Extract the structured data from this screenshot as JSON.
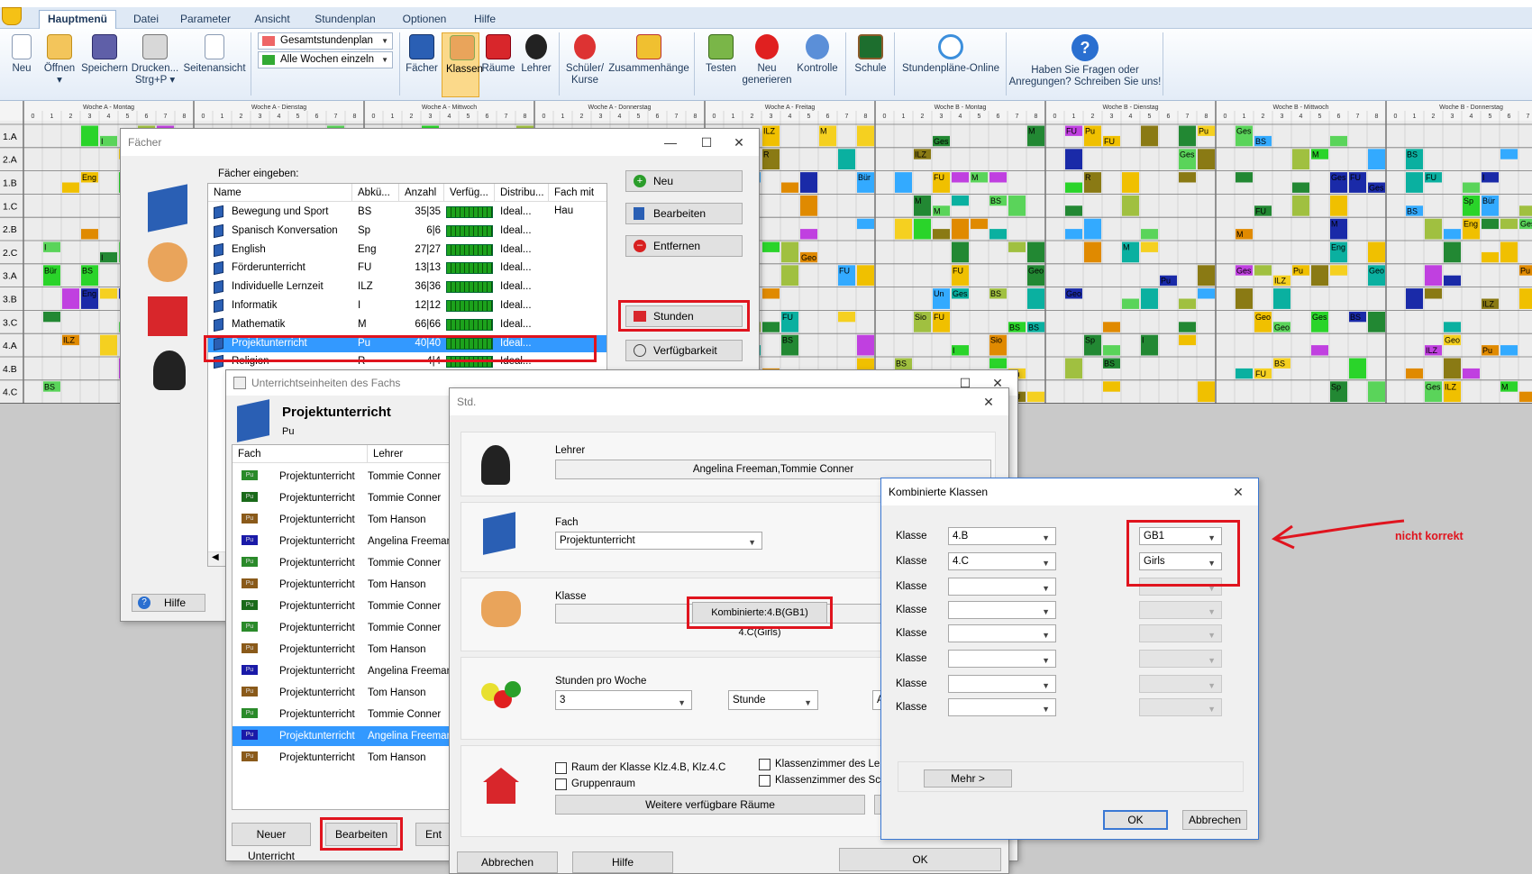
{
  "menu": {
    "tabs": [
      "Hauptmenü",
      "Datei",
      "Parameter",
      "Ansicht",
      "Stundenplan",
      "Optionen",
      "Hilfe"
    ]
  },
  "ribbon": {
    "buttons": [
      {
        "label": "Neu",
        "icon": "new-document-icon"
      },
      {
        "label": "Öffnen",
        "icon": "folder-open-icon"
      },
      {
        "label": "Speichern",
        "icon": "floppy-save-icon"
      },
      {
        "label": "Drucken...",
        "sub": "Strg+P",
        "icon": "printer-icon"
      },
      {
        "label": "Seitenansicht",
        "icon": "print-preview-icon"
      },
      {
        "label": "Fächer",
        "icon": "subjects-book-icon"
      },
      {
        "label": "Klassen",
        "icon": "classes-students-icon"
      },
      {
        "label": "Räume",
        "icon": "rooms-house-icon"
      },
      {
        "label": "Lehrer",
        "icon": "teacher-icon"
      },
      {
        "label": "Schüler/",
        "sub": "Kurse",
        "icon": "student-courses-icon"
      },
      {
        "label": "Zusammenhänge",
        "icon": "relations-icon"
      },
      {
        "label": "Testen",
        "icon": "test-clipboard-icon"
      },
      {
        "label": "Neu",
        "sub": "generieren",
        "icon": "generate-red-button-icon"
      },
      {
        "label": "Kontrolle",
        "icon": "control-icon"
      },
      {
        "label": "Schule",
        "icon": "school-board-icon"
      },
      {
        "label": "Stundenpläne-Online",
        "icon": "online-sync-icon"
      },
      {
        "label": "Haben Sie Fragen oder",
        "sub": "Anregungen? Schreiben Sie uns!",
        "icon": "help-question-icon"
      }
    ],
    "dropdown_view": "Gesamtstundenplan",
    "dropdown_weeks": "Alle Wochen einzeln"
  },
  "grid": {
    "classes": [
      "1.A",
      "2.A",
      "1.B",
      "1.C",
      "2.B",
      "2.C",
      "3.A",
      "3.B",
      "3.C",
      "4.A",
      "4.B",
      "4.C"
    ],
    "days": [
      "Woche A - Montag",
      "Woche A - Dienstag",
      "Woche A - Mittwoch",
      "Woche A - Donnerstag",
      "Woche A - Freitag",
      "Woche B - Montag",
      "Woche B - Dienstag",
      "Woche B - Mittwoch",
      "Woche B - Donnerstag"
    ],
    "periods": [
      "0",
      "1",
      "2",
      "3",
      "4",
      "5",
      "6",
      "7",
      "8"
    ],
    "lesson_labels": [
      "FU",
      "M",
      "M",
      "Ges",
      "Eng",
      "Ges",
      "BS",
      "Pu",
      "ILZ",
      "Geo",
      "FU",
      "BS",
      "M",
      "Sp",
      "Eng",
      "Geo",
      "I",
      "Sio",
      "Un",
      "R",
      "Bür"
    ]
  },
  "faecher": {
    "title": "Fächer",
    "prompt": "Fächer eingeben:",
    "columns": [
      "Name",
      "Abkü...",
      "Anzahl",
      "Verfüg...",
      "Distribu...",
      "Fach mit Hau"
    ],
    "rows": [
      {
        "name": "Bewegung und Sport",
        "abbr": "BS",
        "count": "35|35",
        "dist": "Ideal..."
      },
      {
        "name": "Spanisch Konversation",
        "abbr": "Sp",
        "count": "6|6",
        "dist": "Ideal..."
      },
      {
        "name": "English",
        "abbr": "Eng",
        "count": "27|27",
        "dist": "Ideal..."
      },
      {
        "name": "Förderunterricht",
        "abbr": "FU",
        "count": "13|13",
        "dist": "Ideal..."
      },
      {
        "name": "Individuelle Lernzeit",
        "abbr": "ILZ",
        "count": "36|36",
        "dist": "Ideal..."
      },
      {
        "name": "Informatik",
        "abbr": "I",
        "count": "12|12",
        "dist": "Ideal..."
      },
      {
        "name": "Mathematik",
        "abbr": "M",
        "count": "66|66",
        "dist": "Ideal..."
      },
      {
        "name": "Projektunterricht",
        "abbr": "Pu",
        "count": "40|40",
        "dist": "Ideal..."
      },
      {
        "name": "Religion",
        "abbr": "R",
        "count": "4|4",
        "dist": "Ideal..."
      }
    ],
    "buttons": {
      "neu": "Neu",
      "bearbeiten": "Bearbeiten",
      "entfernen": "Entfernen",
      "stunden": "Stunden",
      "verfuegbarkeit": "Verfügbarkeit",
      "hilfe": "Hilfe"
    }
  },
  "units": {
    "title": "Unterrichtseinheiten des Fachs",
    "subject": "Projektunterricht",
    "abbr": "Pu",
    "columns": [
      "Fach",
      "Lehrer"
    ],
    "rows": [
      {
        "sw": "Pu",
        "fach": "Projektunterricht",
        "lehrer": "Tommie Conner"
      },
      {
        "sw": "Pu",
        "fach": "Projektunterricht",
        "lehrer": "Tommie Conner"
      },
      {
        "sw": "Pu",
        "fach": "Projektunterricht",
        "lehrer": "Tom Hanson"
      },
      {
        "sw": "Pu",
        "fach": "Projektunterricht",
        "lehrer": "Angelina Freeman"
      },
      {
        "sw": "Pu",
        "fach": "Projektunterricht",
        "lehrer": "Tommie Conner"
      },
      {
        "sw": "Pu",
        "fach": "Projektunterricht",
        "lehrer": "Tom Hanson"
      },
      {
        "sw": "Pu",
        "fach": "Projektunterricht",
        "lehrer": "Tommie Conner"
      },
      {
        "sw": "Pu",
        "fach": "Projektunterricht",
        "lehrer": "Tommie Conner"
      },
      {
        "sw": "Pu",
        "fach": "Projektunterricht",
        "lehrer": "Tom Hanson"
      },
      {
        "sw": "Pu",
        "fach": "Projektunterricht",
        "lehrer": "Angelina Freeman"
      },
      {
        "sw": "Pu",
        "fach": "Projektunterricht",
        "lehrer": "Tom Hanson"
      },
      {
        "sw": "Pu",
        "fach": "Projektunterricht",
        "lehrer": "Tommie Conner"
      },
      {
        "sw": "Pu",
        "fach": "Projektunterricht",
        "lehrer": "Angelina Freeman"
      },
      {
        "sw": "Pu",
        "fach": "Projektunterricht",
        "lehrer": "Tom Hanson"
      }
    ],
    "buttons": {
      "neuer": "Neuer Unterricht",
      "bearbeiten": "Bearbeiten",
      "ent": "Ent"
    }
  },
  "std": {
    "title": "Std.",
    "lehrer_label": "Lehrer",
    "lehrer_value": "Angelina Freeman,Tommie Conner",
    "fach_label": "Fach",
    "fach_value": "Projektunterricht",
    "klasse_label": "Klasse",
    "klasse_value": "Kombinierte:4.B(GB1) 4.C(Girls)",
    "stunden_label": "Stunden pro Woche",
    "stunden_value": "3",
    "stunde_unit": "Stunde",
    "stunde_extra": "A",
    "raum_check": "Raum der Klasse Klz.4.B, Klz.4.C",
    "gruppen_check": "Gruppenraum",
    "klassenzimmer_lehrer": "Klassenzimmer des Lehr",
    "klassenzimmer_schule": "Klassenzimmer des Schu",
    "weitere_button": "Weitere verfügbare Räume",
    "abbrechen": "Abbrechen",
    "hilfe": "Hilfe",
    "ok": "OK"
  },
  "kombi": {
    "title": "Kombinierte Klassen",
    "row_label": "Klasse",
    "rows": [
      {
        "klasse": "4.B",
        "gruppe": "GB1"
      },
      {
        "klasse": "4.C",
        "gruppe": "Girls"
      },
      {
        "klasse": "",
        "gruppe": ""
      },
      {
        "klasse": "",
        "gruppe": ""
      },
      {
        "klasse": "",
        "gruppe": ""
      },
      {
        "klasse": "",
        "gruppe": ""
      },
      {
        "klasse": "",
        "gruppe": ""
      },
      {
        "klasse": "",
        "gruppe": ""
      }
    ],
    "mehr": "Mehr >",
    "ok": "OK",
    "abbrechen": "Abbrechen"
  },
  "annotation": {
    "text": "nicht korrekt"
  }
}
